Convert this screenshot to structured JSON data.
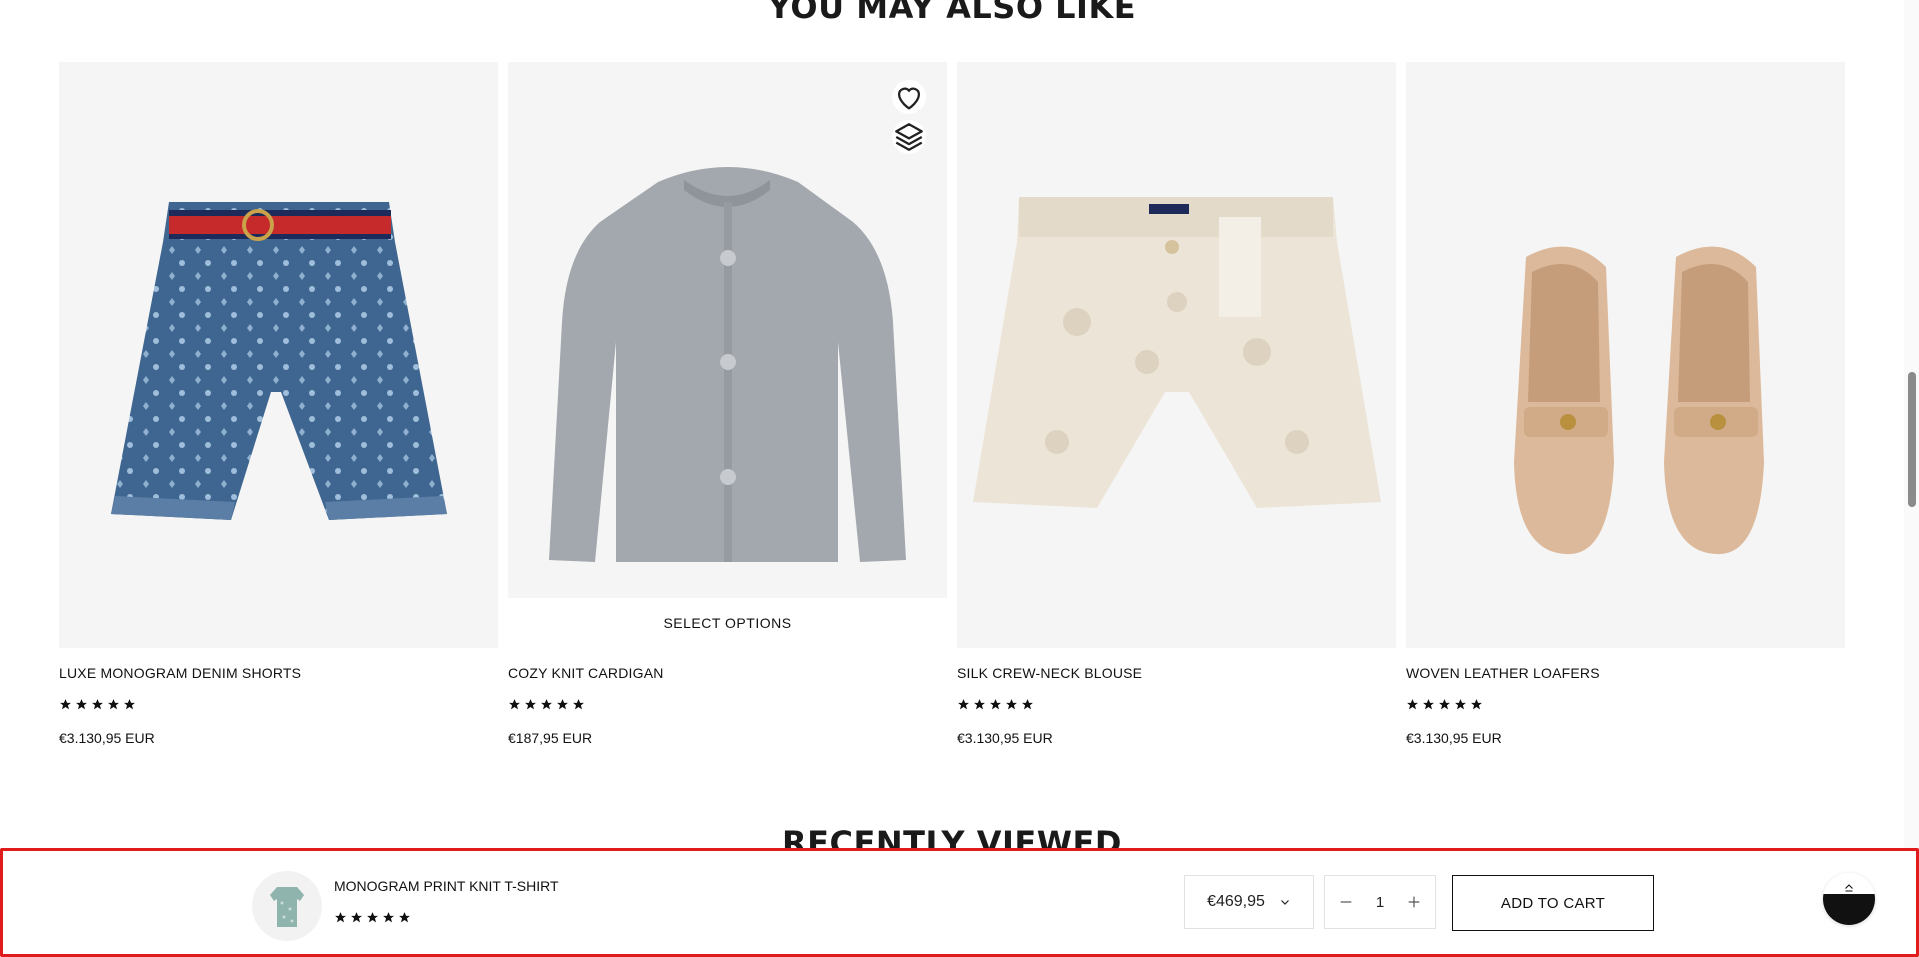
{
  "sections": {
    "you_may_also_like": "YOU MAY ALSO LIKE",
    "recently_viewed": "RECENTLY VIEWED"
  },
  "products": [
    {
      "name": "LUXE MONOGRAM DENIM SHORTS",
      "price": "€3.130,95 EUR",
      "rating": 5
    },
    {
      "name": "COZY KNIT CARDIGAN",
      "price": "€187,95 EUR",
      "rating": 5,
      "hover_action": "SELECT OPTIONS"
    },
    {
      "name": "SILK CREW-NECK BLOUSE",
      "price": "€3.130,95 EUR",
      "rating": 5
    },
    {
      "name": "WOVEN LEATHER LOAFERS",
      "price": "€3.130,95 EUR",
      "rating": 5
    }
  ],
  "sticky_bar": {
    "product_name": "MONOGRAM PRINT KNIT T-SHIRT",
    "rating": 5,
    "variant_price": "€469,95",
    "quantity": "1",
    "add_to_cart": "ADD TO CART"
  },
  "icons": {
    "wishlist": "heart-icon",
    "compare": "layers-icon",
    "rating": "star-icon",
    "dropdown": "chevron-down-icon",
    "minus": "minus-icon",
    "plus": "plus-icon",
    "back_to_top": "arrow-up-icon"
  },
  "colors": {
    "highlight_border": "#e01b1b",
    "card_bg": "#f5f5f5",
    "text": "#111111"
  }
}
